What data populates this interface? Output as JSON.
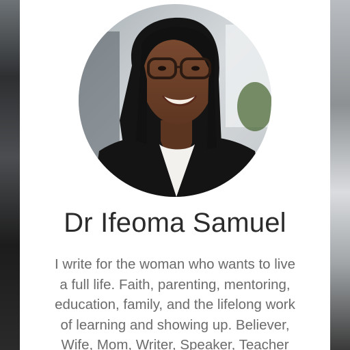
{
  "profile": {
    "name": "Dr Ifeoma Samuel",
    "bio_lines": [
      "I write for the woman who wants to live",
      "a full life. Faith, parenting, mentoring,",
      "education, family, and the lifelong work",
      "of learning and showing up. Believer,",
      "Wife, Mom, Writer, Speaker, Teacher"
    ],
    "avatar_icon": "profile-photo"
  },
  "colors": {
    "card_background": "#ffffff",
    "name_text": "#2b2b2b",
    "bio_text": "#6b6b6b"
  }
}
